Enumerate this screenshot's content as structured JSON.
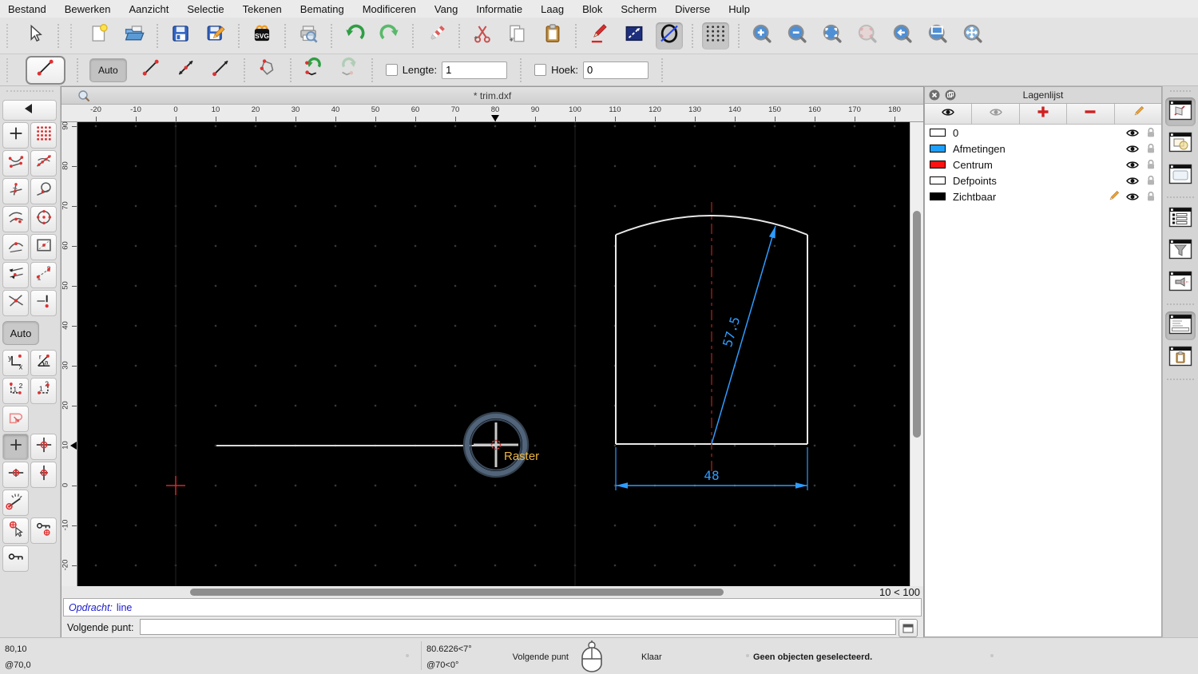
{
  "menu": {
    "items": [
      "Bestand",
      "Bewerken",
      "Aanzicht",
      "Selectie",
      "Tekenen",
      "Bemating",
      "Modificeren",
      "Vang",
      "Informatie",
      "Laag",
      "Blok",
      "Scherm",
      "Diverse",
      "Hulp"
    ]
  },
  "toolbar": {
    "items": [
      {
        "name": "pointer",
        "icon": "pointer"
      },
      {
        "name": "new-file",
        "icon": "new-file",
        "sep": true
      },
      {
        "name": "open-file",
        "icon": "open-folder"
      },
      {
        "name": "save-file",
        "icon": "save",
        "sep": true
      },
      {
        "name": "save-file-as",
        "icon": "save-as"
      },
      {
        "name": "export-svg",
        "icon": "svg-export",
        "sep": true
      },
      {
        "name": "print-preview",
        "icon": "print-preview",
        "sep": true
      },
      {
        "name": "undo",
        "icon": "undo",
        "sep": true
      },
      {
        "name": "redo",
        "icon": "redo"
      },
      {
        "name": "delete-selected",
        "icon": "eraser",
        "sep": true
      },
      {
        "name": "cut",
        "icon": "cut",
        "sep": true
      },
      {
        "name": "copy",
        "icon": "copy"
      },
      {
        "name": "paste",
        "icon": "paste"
      },
      {
        "name": "edit-pen",
        "icon": "pen",
        "sep": true
      },
      {
        "name": "attributes",
        "icon": "attributes"
      },
      {
        "name": "draft-mode-toggle",
        "icon": "draft",
        "active": true
      },
      {
        "name": "grid-toggle",
        "icon": "grid",
        "active": true,
        "sep": true
      },
      {
        "name": "zoom-in",
        "icon": "zoom-in",
        "sep": true
      },
      {
        "name": "zoom-out",
        "icon": "zoom-out"
      },
      {
        "name": "zoom-auto",
        "icon": "zoom-auto"
      },
      {
        "name": "zoom-previous",
        "icon": "zoom-previous",
        "disabled": true
      },
      {
        "name": "zoom-back",
        "icon": "zoom-back"
      },
      {
        "name": "zoom-window",
        "icon": "zoom-window"
      },
      {
        "name": "zoom-pan",
        "icon": "zoom-pan"
      }
    ]
  },
  "tool_options": {
    "auto_label": "Auto",
    "buttons": [
      {
        "name": "line-plain",
        "icon": "opt-line"
      },
      {
        "name": "line-both-arrows",
        "icon": "opt-line-both"
      },
      {
        "name": "line-end-arrow",
        "icon": "opt-line-arrow"
      },
      {
        "name": "polyline-close",
        "icon": "opt-polygon",
        "sep": true
      },
      {
        "name": "undo-segment",
        "icon": "opt-undo",
        "sep": true
      },
      {
        "name": "redo-segment",
        "icon": "opt-redo",
        "disabled": true
      }
    ],
    "lengte_label": "Lengte:",
    "lengte_value": "1",
    "hoek_label": "Hoek:",
    "hoek_value": "0"
  },
  "snap_sidebar": {
    "auto_label": "Auto",
    "rows": [
      {
        "type": "handle"
      },
      {
        "type": "wide",
        "items": [
          {
            "name": "collapse-toolbar",
            "icon": "back"
          }
        ]
      },
      {
        "type": "pair",
        "items": [
          {
            "name": "snap-free",
            "icon": "snap-free"
          },
          {
            "name": "snap-grid",
            "icon": "snap-grid"
          }
        ]
      },
      {
        "type": "pair",
        "items": [
          {
            "name": "snap-endpoints",
            "icon": "snap-endpoints"
          },
          {
            "name": "snap-on-entity",
            "icon": "snap-on-entity"
          }
        ]
      },
      {
        "type": "pair",
        "items": [
          {
            "name": "snap-perpendicular",
            "icon": "snap-perpendicular"
          },
          {
            "name": "snap-tangent",
            "icon": "snap-tangent"
          }
        ]
      },
      {
        "type": "pair",
        "items": [
          {
            "name": "snap-nearest",
            "icon": "snap-nearest"
          },
          {
            "name": "snap-center",
            "icon": "snap-center"
          }
        ]
      },
      {
        "type": "pair",
        "items": [
          {
            "name": "snap-middle",
            "icon": "snap-middle"
          },
          {
            "name": "snap-reference",
            "icon": "snap-reference"
          }
        ]
      },
      {
        "type": "pair",
        "items": [
          {
            "name": "snap-restrict-angles",
            "icon": "restrict-angles"
          },
          {
            "name": "snap-distance",
            "icon": "snap-distance"
          }
        ]
      },
      {
        "type": "pair",
        "items": [
          {
            "name": "snap-intersection",
            "icon": "snap-intersection"
          },
          {
            "name": "snap-intersection-manual",
            "icon": "snap-intersection-manual"
          }
        ]
      },
      {
        "type": "auto"
      },
      {
        "type": "pair",
        "items": [
          {
            "name": "coordinate-cartesian",
            "icon": "coord-cartesian"
          },
          {
            "name": "coordinate-polar",
            "icon": "coord-polar"
          }
        ]
      },
      {
        "type": "pair",
        "items": [
          {
            "name": "relative-point-1-2",
            "icon": "rel-12"
          },
          {
            "name": "relative-point-2-1",
            "icon": "rel-21"
          }
        ]
      },
      {
        "type": "single",
        "items": [
          {
            "name": "snap-exclusive",
            "icon": "snap-exclusive"
          }
        ]
      },
      {
        "type": "pair",
        "items": [
          {
            "name": "restrict-nothing",
            "icon": "restrict-nothing",
            "active": true
          },
          {
            "name": "restrict-orthogonal",
            "icon": "restrict-orthogonal"
          }
        ]
      },
      {
        "type": "pair",
        "items": [
          {
            "name": "restrict-horizontal",
            "icon": "restrict-horizontal"
          },
          {
            "name": "restrict-vertical",
            "icon": "restrict-vertical"
          }
        ]
      },
      {
        "type": "single",
        "items": [
          {
            "name": "angle-gauge",
            "icon": "angle-gauge"
          }
        ]
      },
      {
        "type": "pair",
        "items": [
          {
            "name": "set-relative-zero",
            "icon": "set-rel-zero"
          },
          {
            "name": "lock-relative-zero",
            "icon": "lock-rel-zero"
          }
        ]
      },
      {
        "type": "single",
        "items": [
          {
            "name": "relative-zero-key",
            "icon": "key"
          }
        ]
      }
    ]
  },
  "document": {
    "title": "* trim.dxf",
    "zoom_indicator": "10 < 100",
    "hruler": {
      "ticks": [
        -20,
        -10,
        0,
        10,
        20,
        30,
        40,
        50,
        60,
        70,
        80,
        90,
        100,
        110,
        120,
        130,
        140,
        150,
        160,
        170,
        180
      ],
      "marker": 80
    },
    "vruler": {
      "ticks": [
        90,
        80,
        70,
        60,
        50,
        40,
        30,
        20,
        10,
        0,
        -10,
        -20
      ],
      "marker": 10
    },
    "drawing": {
      "raster_label": "Raster",
      "radial_dim": "57.5",
      "width_dim": "48",
      "colors": {
        "dimension": "#2e9bfe",
        "centerline": "#8c1d18",
        "outline": "#e8e8e8",
        "snap_label": "#eab43e",
        "snap_ring": "#4d5f74"
      }
    }
  },
  "command": {
    "history_prefix": "Opdracht:",
    "history_text": "line",
    "prompt_label": "Volgende punt:",
    "prompt_value": ""
  },
  "layer_panel": {
    "title": "Lagenlijst",
    "toolbar": [
      {
        "name": "show-all-layers",
        "icon": "eye"
      },
      {
        "name": "hide-all-layers",
        "icon": "eye-gray"
      },
      {
        "name": "add-layer",
        "icon": "plus-red"
      },
      {
        "name": "remove-layer",
        "icon": "minus-red"
      },
      {
        "name": "edit-layer",
        "icon": "pencil"
      }
    ],
    "layers": [
      {
        "name": "0",
        "color": "#ffffff",
        "visible": true,
        "locked": false,
        "current": false
      },
      {
        "name": "Afmetingen",
        "color": "#1e9fff",
        "visible": true,
        "locked": false,
        "current": false
      },
      {
        "name": "Centrum",
        "color": "#ff1111",
        "visible": true,
        "locked": false,
        "current": false
      },
      {
        "name": "Defpoints",
        "color": "#ffffff",
        "visible": true,
        "locked": false,
        "current": false
      },
      {
        "name": "Zichtbaar",
        "color": "#000000",
        "visible": true,
        "locked": false,
        "current": true
      }
    ]
  },
  "dock": {
    "items": [
      {
        "name": "dock-pen-properties",
        "icon": "win-pen",
        "active": true
      },
      {
        "name": "dock-blocks",
        "icon": "win-blocks"
      },
      {
        "name": "dock-library",
        "icon": "win-library"
      },
      {
        "name": "dock-layer-list",
        "icon": "win-list",
        "sep": true
      },
      {
        "name": "dock-filter",
        "icon": "win-filter"
      },
      {
        "name": "dock-projection",
        "icon": "win-proj"
      },
      {
        "name": "dock-command-line",
        "icon": "win-cmd",
        "active": true,
        "sep": true
      },
      {
        "name": "dock-clipboard",
        "icon": "win-clip"
      }
    ]
  },
  "status": {
    "abs_coord": "80,10",
    "rel_coord": "@70,0",
    "abs_polar": "80.6226<7°",
    "rel_polar": "@70<0°",
    "mouse_left_hint": "Volgende punt",
    "mouse_right_hint": "Klaar",
    "selection_info": "Geen objecten geselecteerd."
  }
}
